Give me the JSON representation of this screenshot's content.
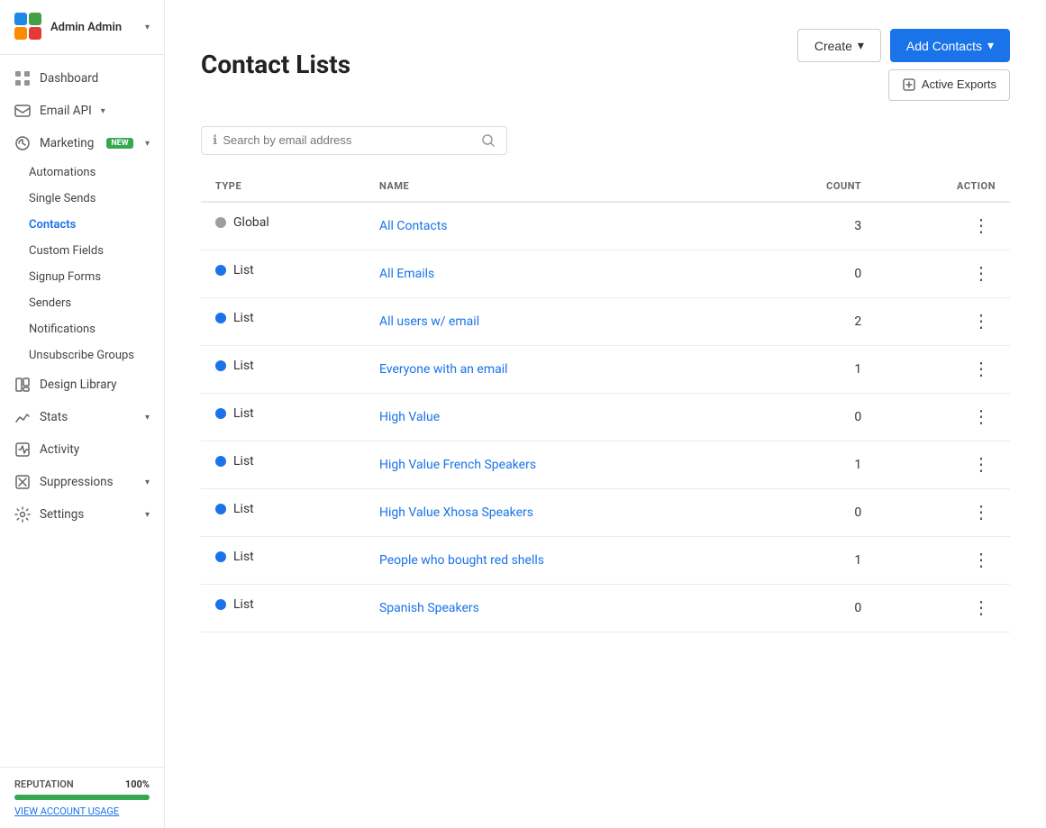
{
  "app": {
    "admin_label": "Admin Admin",
    "logo_colors": [
      "#1e88e5",
      "#43a047"
    ]
  },
  "sidebar": {
    "items": [
      {
        "id": "dashboard",
        "label": "Dashboard",
        "icon": "dashboard-icon"
      },
      {
        "id": "email-api",
        "label": "Email API",
        "icon": "email-api-icon",
        "has_chevron": true
      },
      {
        "id": "marketing",
        "label": "Marketing",
        "icon": "marketing-icon",
        "has_chevron": true,
        "badge": "NEW"
      }
    ],
    "marketing_sub_items": [
      {
        "id": "automations",
        "label": "Automations"
      },
      {
        "id": "single-sends",
        "label": "Single Sends"
      },
      {
        "id": "contacts",
        "label": "Contacts",
        "active": true
      },
      {
        "id": "custom-fields",
        "label": "Custom Fields"
      },
      {
        "id": "signup-forms",
        "label": "Signup Forms"
      },
      {
        "id": "senders",
        "label": "Senders"
      },
      {
        "id": "notifications",
        "label": "Notifications"
      },
      {
        "id": "unsubscribe-groups",
        "label": "Unsubscribe Groups"
      }
    ],
    "other_items": [
      {
        "id": "design-library",
        "label": "Design Library",
        "icon": "design-library-icon"
      },
      {
        "id": "stats",
        "label": "Stats",
        "icon": "stats-icon",
        "has_chevron": true
      },
      {
        "id": "activity",
        "label": "Activity",
        "icon": "activity-icon"
      },
      {
        "id": "suppressions",
        "label": "Suppressions",
        "icon": "suppressions-icon",
        "has_chevron": true
      },
      {
        "id": "settings",
        "label": "Settings",
        "icon": "settings-icon",
        "has_chevron": true
      }
    ],
    "reputation": {
      "label": "Reputation",
      "value": "100%",
      "fill_percent": 100
    },
    "view_usage": "View Account Usage"
  },
  "main": {
    "title": "Contact Lists",
    "buttons": {
      "create": "Create",
      "add_contacts": "Add Contacts",
      "active_exports": "Active Exports"
    },
    "search": {
      "placeholder": "Search by email address"
    },
    "table": {
      "headers": [
        "TYPE",
        "NAME",
        "COUNT",
        "ACTION"
      ],
      "rows": [
        {
          "type": "Global",
          "dot": "gray",
          "name": "All Contacts",
          "count": "3"
        },
        {
          "type": "List",
          "dot": "blue",
          "name": "All Emails",
          "count": "0"
        },
        {
          "type": "List",
          "dot": "blue",
          "name": "All users w/ email",
          "count": "2"
        },
        {
          "type": "List",
          "dot": "blue",
          "name": "Everyone with an email",
          "count": "1"
        },
        {
          "type": "List",
          "dot": "blue",
          "name": "High Value",
          "count": "0"
        },
        {
          "type": "List",
          "dot": "blue",
          "name": "High Value French Speakers",
          "count": "1"
        },
        {
          "type": "List",
          "dot": "blue",
          "name": "High Value Xhosa Speakers",
          "count": "0"
        },
        {
          "type": "List",
          "dot": "blue",
          "name": "People who bought red shells",
          "count": "1"
        },
        {
          "type": "List",
          "dot": "blue",
          "name": "Spanish Speakers",
          "count": "0"
        }
      ]
    }
  }
}
